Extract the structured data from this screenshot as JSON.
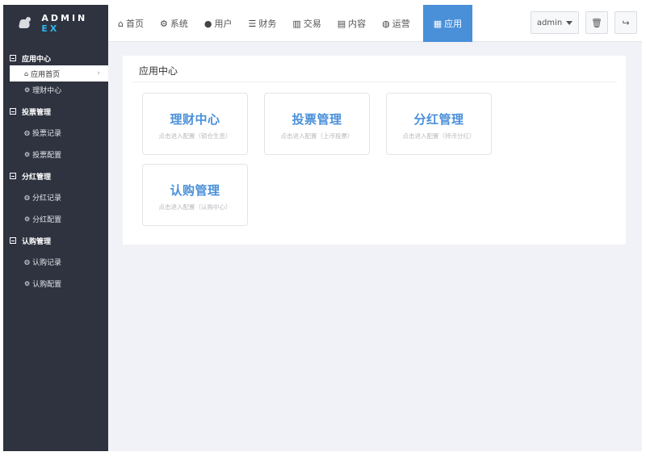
{
  "app": {
    "logo_text": "ADMIN",
    "logo_suffix": "EX"
  },
  "nav": {
    "items": [
      {
        "icon": "home-icon",
        "glyph": "⌂",
        "label": "首页"
      },
      {
        "icon": "gear-icon",
        "glyph": "⚙",
        "label": "系统"
      },
      {
        "icon": "user-icon",
        "glyph": "●",
        "label": "用户"
      },
      {
        "icon": "list-icon",
        "glyph": "☰",
        "label": "财务"
      },
      {
        "icon": "bar-chart-icon",
        "glyph": "▥",
        "label": "交易"
      },
      {
        "icon": "content-icon",
        "glyph": "▤",
        "label": "内容"
      },
      {
        "icon": "globe-icon",
        "glyph": "◍",
        "label": "运营"
      },
      {
        "icon": "grid-icon",
        "glyph": "▦",
        "label": "应用"
      }
    ]
  },
  "header": {
    "user_label": "admin",
    "trash_glyph": "🗑",
    "logout_glyph": "↪"
  },
  "sidebar": {
    "groups": [
      {
        "label": "应用中心",
        "items": [
          {
            "label": "应用首页",
            "icon": "home-icon",
            "glyph": "⌂"
          },
          {
            "label": "理财中心",
            "icon": "gear-icon",
            "glyph": "⚙"
          }
        ]
      },
      {
        "label": "投票管理",
        "items": [
          {
            "label": "投票记录",
            "icon": "globe-icon",
            "glyph": "◍"
          },
          {
            "label": "投票配置",
            "icon": "gear-icon",
            "glyph": "⚙"
          }
        ]
      },
      {
        "label": "分红管理",
        "items": [
          {
            "label": "分红记录",
            "icon": "globe-icon",
            "glyph": "◍"
          },
          {
            "label": "分红配置",
            "icon": "gear-icon",
            "glyph": "⚙"
          }
        ]
      },
      {
        "label": "认购管理",
        "items": [
          {
            "label": "认购记录",
            "icon": "globe-icon",
            "glyph": "◍"
          },
          {
            "label": "认购配置",
            "icon": "gear-icon",
            "glyph": "⚙"
          }
        ]
      }
    ],
    "chevron": "›"
  },
  "main": {
    "title": "应用中心",
    "cards": [
      {
        "title": "理财中心",
        "desc": "点击进入配置（锁仓生息）"
      },
      {
        "title": "投票管理",
        "desc": "点击进入配置（上币投票）"
      },
      {
        "title": "分红管理",
        "desc": "点击进入配置（持币分红）"
      },
      {
        "title": "认购管理",
        "desc": "点击进入配置（认购中心）"
      }
    ]
  },
  "colors": {
    "accent": "#4a90d9",
    "sidebar_bg": "#2f3340",
    "logo_suffix": "#2fb7ea"
  }
}
